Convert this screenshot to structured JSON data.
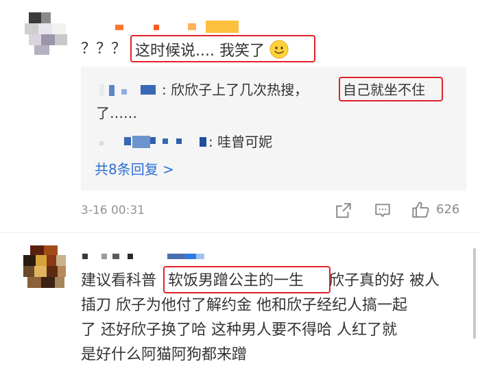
{
  "comment1": {
    "prefix": "？？？",
    "highlight": "这时候说.... 我笑了",
    "emoji": "smile-emoji",
    "replies": [
      {
        "text": ": 欣欣子上了几次热搜，",
        "highlight": "自己就坐不住",
        "wrap": "了……"
      },
      {
        "text": ": 哇曾可妮"
      }
    ],
    "more_link": "共8条回复 >",
    "timestamp": "3-16 00:31",
    "like_count": "626"
  },
  "comment2": {
    "line1_prefix": "建议看科普",
    "line1_highlight": "软饭男蹭公主的一生",
    "line1_suffix": " 欣子真的好 被人",
    "line2": "插刀 欣子为他付了解约金 他和欣子经纪人搞一起",
    "line3": "了 还好欣子换了哈 这种男人要不得哈 人红了就",
    "line4": "是好什么阿猫阿狗都来蹭"
  },
  "colors": {
    "link": "#2a6fd6",
    "highlight_box": "#e0202a",
    "meta": "#939393",
    "reply_bg": "#f5f5f5"
  }
}
